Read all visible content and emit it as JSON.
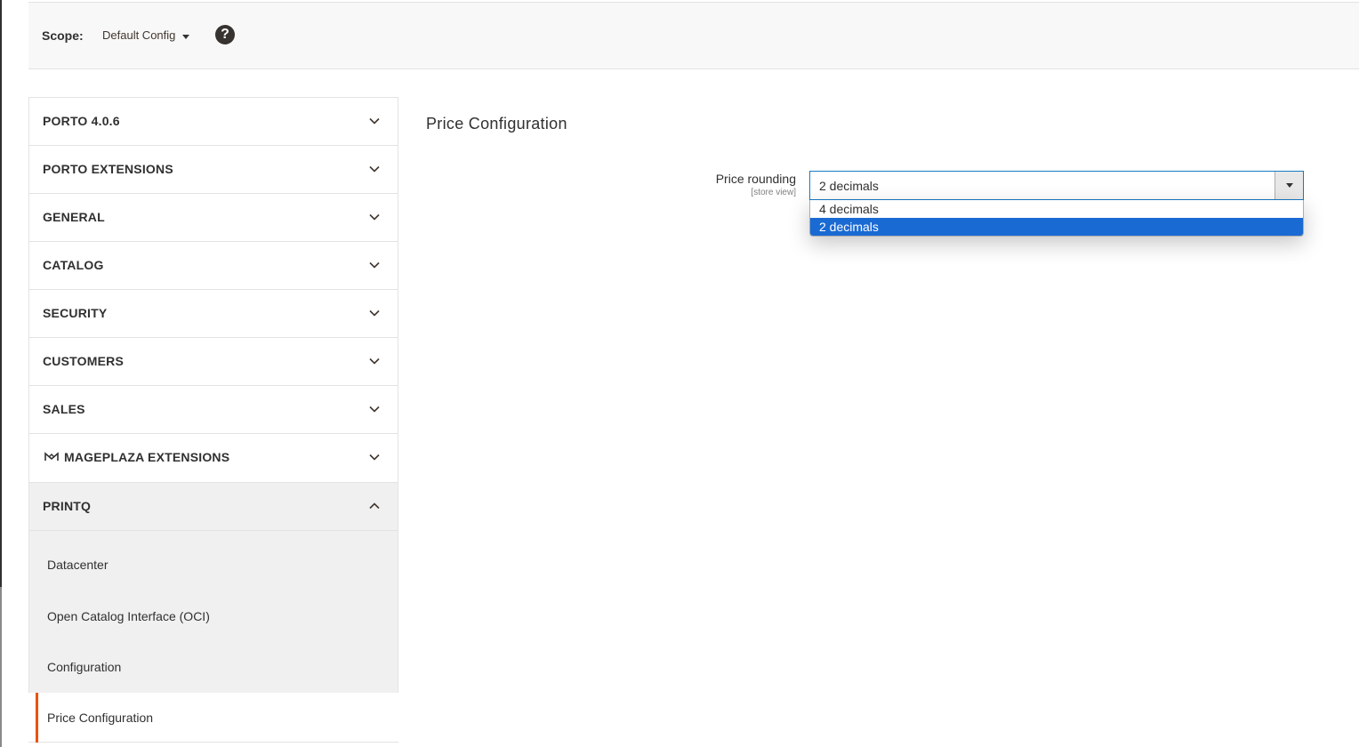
{
  "scope": {
    "label": "Scope:",
    "value": "Default Config",
    "help": "?"
  },
  "sidebar": {
    "sections": [
      {
        "label": "PORTO 4.0.6",
        "expanded": false
      },
      {
        "label": "PORTO EXTENSIONS",
        "expanded": false
      },
      {
        "label": "GENERAL",
        "expanded": false
      },
      {
        "label": "CATALOG",
        "expanded": false
      },
      {
        "label": "SECURITY",
        "expanded": false
      },
      {
        "label": "CUSTOMERS",
        "expanded": false
      },
      {
        "label": "SALES",
        "expanded": false
      },
      {
        "label": "MAGEPLAZA EXTENSIONS",
        "expanded": false,
        "icon": "mageplaza-icon"
      },
      {
        "label": "PRINTQ",
        "expanded": true
      }
    ],
    "printq_items": [
      "Datacenter",
      "Open Catalog Interface (OCI)",
      "Configuration"
    ],
    "active_item": "Price Configuration",
    "active_color": "#eb5202"
  },
  "main": {
    "title": "Price Configuration",
    "field": {
      "label": "Price rounding",
      "scope": "[store view]",
      "value": "2 decimals",
      "options": [
        "4 decimals",
        "2 decimals"
      ],
      "selected_index": 1
    }
  }
}
